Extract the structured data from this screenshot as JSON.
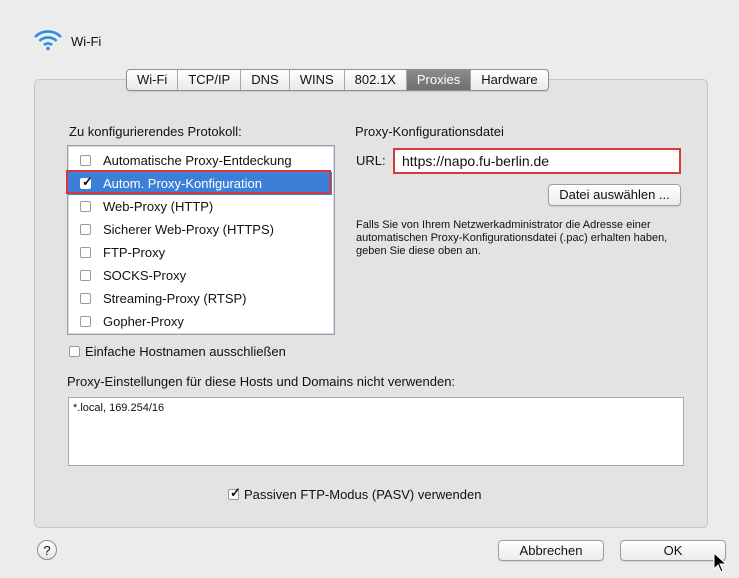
{
  "header": {
    "title": "Wi-Fi",
    "icon": "wifi-icon"
  },
  "tabs": [
    {
      "label": "Wi-Fi",
      "active": false
    },
    {
      "label": "TCP/IP",
      "active": false
    },
    {
      "label": "DNS",
      "active": false
    },
    {
      "label": "WINS",
      "active": false
    },
    {
      "label": "802.1X",
      "active": false
    },
    {
      "label": "Proxies",
      "active": true
    },
    {
      "label": "Hardware",
      "active": false
    }
  ],
  "protocol_section": {
    "label": "Zu konfigurierendes Protokoll:",
    "items": [
      {
        "label": "Automatische Proxy-Entdeckung",
        "checked": false,
        "selected": false
      },
      {
        "label": "Autom. Proxy-Konfiguration",
        "checked": true,
        "selected": true
      },
      {
        "label": "Web-Proxy (HTTP)",
        "checked": false,
        "selected": false
      },
      {
        "label": "Sicherer Web-Proxy (HTTPS)",
        "checked": false,
        "selected": false
      },
      {
        "label": "FTP-Proxy",
        "checked": false,
        "selected": false
      },
      {
        "label": "SOCKS-Proxy",
        "checked": false,
        "selected": false
      },
      {
        "label": "Streaming-Proxy (RTSP)",
        "checked": false,
        "selected": false
      },
      {
        "label": "Gopher-Proxy",
        "checked": false,
        "selected": false
      }
    ]
  },
  "config_section": {
    "heading": "Proxy-Konfigurationsdatei",
    "url_label": "URL:",
    "url_value": "https://napo.fu-berlin.de",
    "choose_button": "Datei auswählen ...",
    "help_text": "Falls Sie von Ihrem Netzwerkadministrator die Adresse einer automatischen Proxy-Konfigurationsdatei (.pac) erhalten haben, geben Sie diese oben an."
  },
  "exclude_simple_hostnames": {
    "label": "Einfache Hostnamen ausschließen",
    "checked": false
  },
  "bypass": {
    "label": "Proxy-Einstellungen für diese Hosts und Domains nicht verwenden:",
    "value": "*.local, 169.254/16"
  },
  "passive_ftp": {
    "label": "Passiven FTP-Modus (PASV) verwenden",
    "checked": true
  },
  "footer": {
    "help": "?",
    "cancel": "Abbrechen",
    "ok": "OK"
  },
  "colors": {
    "selection": "#3b7fd8",
    "highlight": "#d43a3a",
    "wifi": "#2f8fe8"
  }
}
